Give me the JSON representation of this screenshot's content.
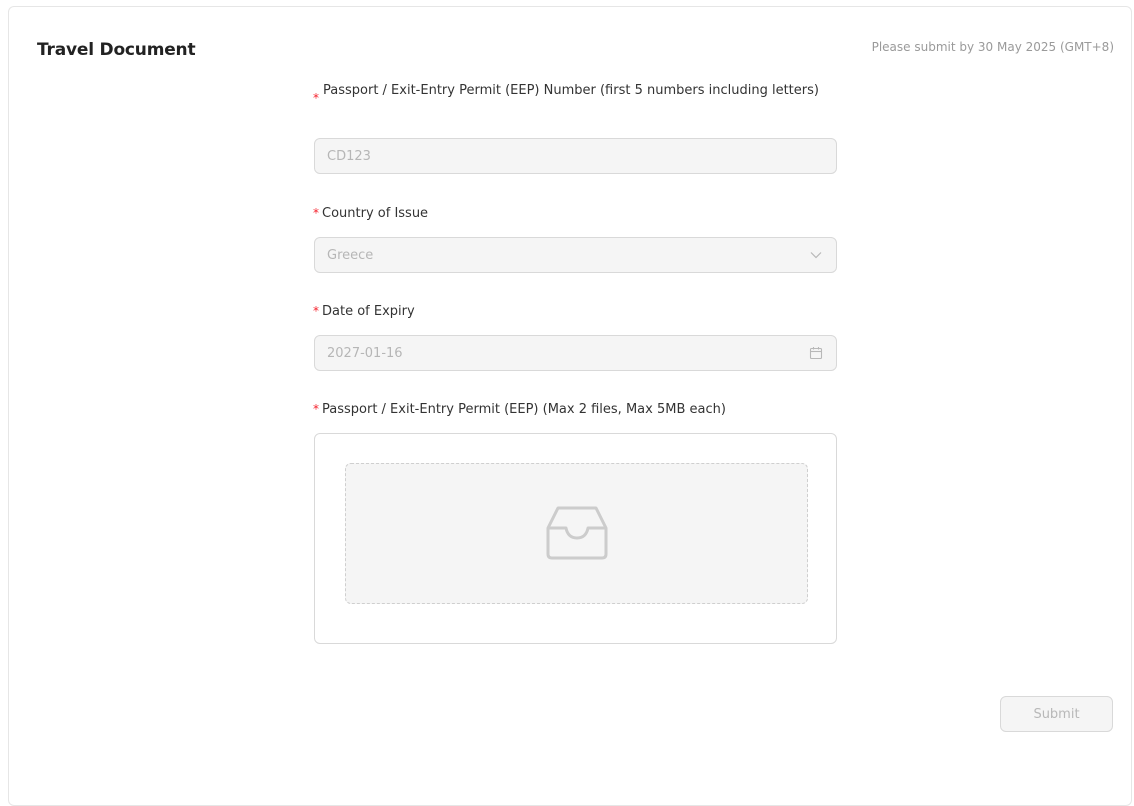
{
  "section": {
    "title": "Travel Document",
    "deadline": "Please submit by 30 May 2025 (GMT+8)"
  },
  "form": {
    "required_mark": "*",
    "passport_number": {
      "label": "Passport / Exit-Entry Permit (EEP) Number (first 5 numbers including letters)",
      "value": "CD123"
    },
    "country_of_issue": {
      "label": "Country of Issue",
      "value": "Greece",
      "icon": "chevron-down-icon"
    },
    "date_of_expiry": {
      "label": "Date of Expiry",
      "value": "2027-01-16",
      "icon": "calendar-icon"
    },
    "passport_upload": {
      "label": "Passport / Exit-Entry Permit (EEP) (Max 2 files, Max 5MB each)",
      "icon": "inbox-icon"
    },
    "submit_label": "Submit"
  },
  "colors": {
    "required": "#f5222d",
    "disabled_bg": "#f5f5f5",
    "border": "#d9d9d9",
    "muted_text": "#b6b6b6"
  }
}
